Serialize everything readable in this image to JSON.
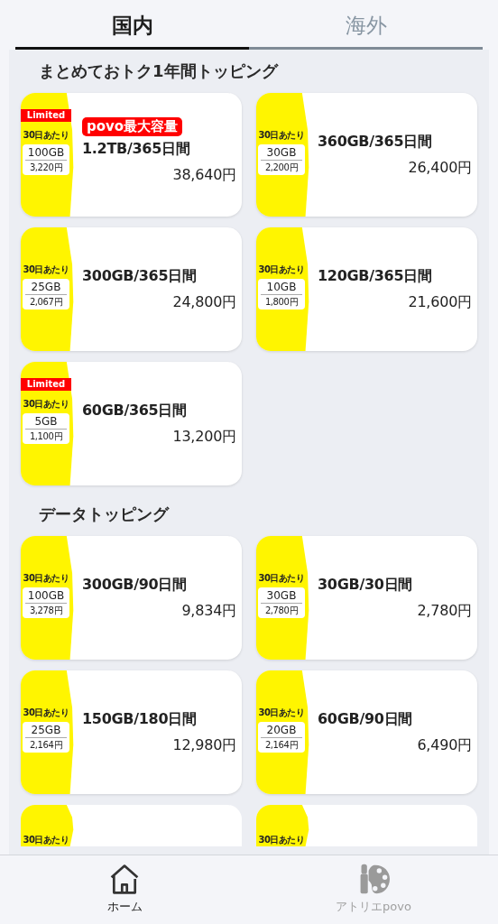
{
  "tabs": [
    {
      "label": "国内",
      "selected": true
    },
    {
      "label": "海外",
      "selected": false
    }
  ],
  "sections": [
    {
      "title": "まとめておトク1年間トッピング",
      "cards": [
        {
          "kind": "full",
          "limited": "Limited",
          "per": "30日あたり",
          "amount": "100GB",
          "unit_price": "3,220円",
          "badge": "povo最大容量",
          "title": "1.2TB/365日間",
          "price": "38,640円"
        },
        {
          "kind": "full",
          "limited": false,
          "per": "30日あたり",
          "amount": "30GB",
          "unit_price": "2,200円",
          "title": "360GB/365日間",
          "price": "26,400円"
        },
        {
          "kind": "full",
          "limited": false,
          "per": "30日あたり",
          "amount": "25GB",
          "unit_price": "2,067円",
          "title": "300GB/365日間",
          "price": "24,800円"
        },
        {
          "kind": "full",
          "limited": false,
          "per": "30日あたり",
          "amount": "10GB",
          "unit_price": "1,800円",
          "title": "120GB/365日間",
          "price": "21,600円"
        },
        {
          "kind": "full",
          "limited": "Limited",
          "per": "30日あたり",
          "amount": "5GB",
          "unit_price": "1,100円",
          "title": "60GB/365日間",
          "price": "13,200円"
        }
      ]
    },
    {
      "title": "データトッピング",
      "cards": [
        {
          "kind": "full",
          "limited": false,
          "per": "30日あたり",
          "amount": "100GB",
          "unit_price": "3,278円",
          "title": "300GB/90日間",
          "price": "9,834円"
        },
        {
          "kind": "full",
          "limited": false,
          "per": "30日あたり",
          "amount": "30GB",
          "unit_price": "2,780円",
          "title": "30GB/30日間",
          "price": "2,780円"
        },
        {
          "kind": "full",
          "limited": false,
          "per": "30日あたり",
          "amount": "25GB",
          "unit_price": "2,164円",
          "title": "150GB/180日間",
          "price": "12,980円"
        },
        {
          "kind": "full",
          "limited": false,
          "per": "30日あたり",
          "amount": "20GB",
          "unit_price": "2,164円",
          "title": "60GB/90日間",
          "price": "6,490円"
        },
        {
          "kind": "partial",
          "limited": false,
          "per": "30日あたり"
        },
        {
          "kind": "partial",
          "limited": false,
          "per": "30日あたり"
        }
      ]
    }
  ],
  "nav": [
    {
      "label": "ホーム",
      "kind": "home",
      "selected": true
    },
    {
      "label": "アトリエpovo",
      "kind": "palette",
      "selected": false
    }
  ]
}
